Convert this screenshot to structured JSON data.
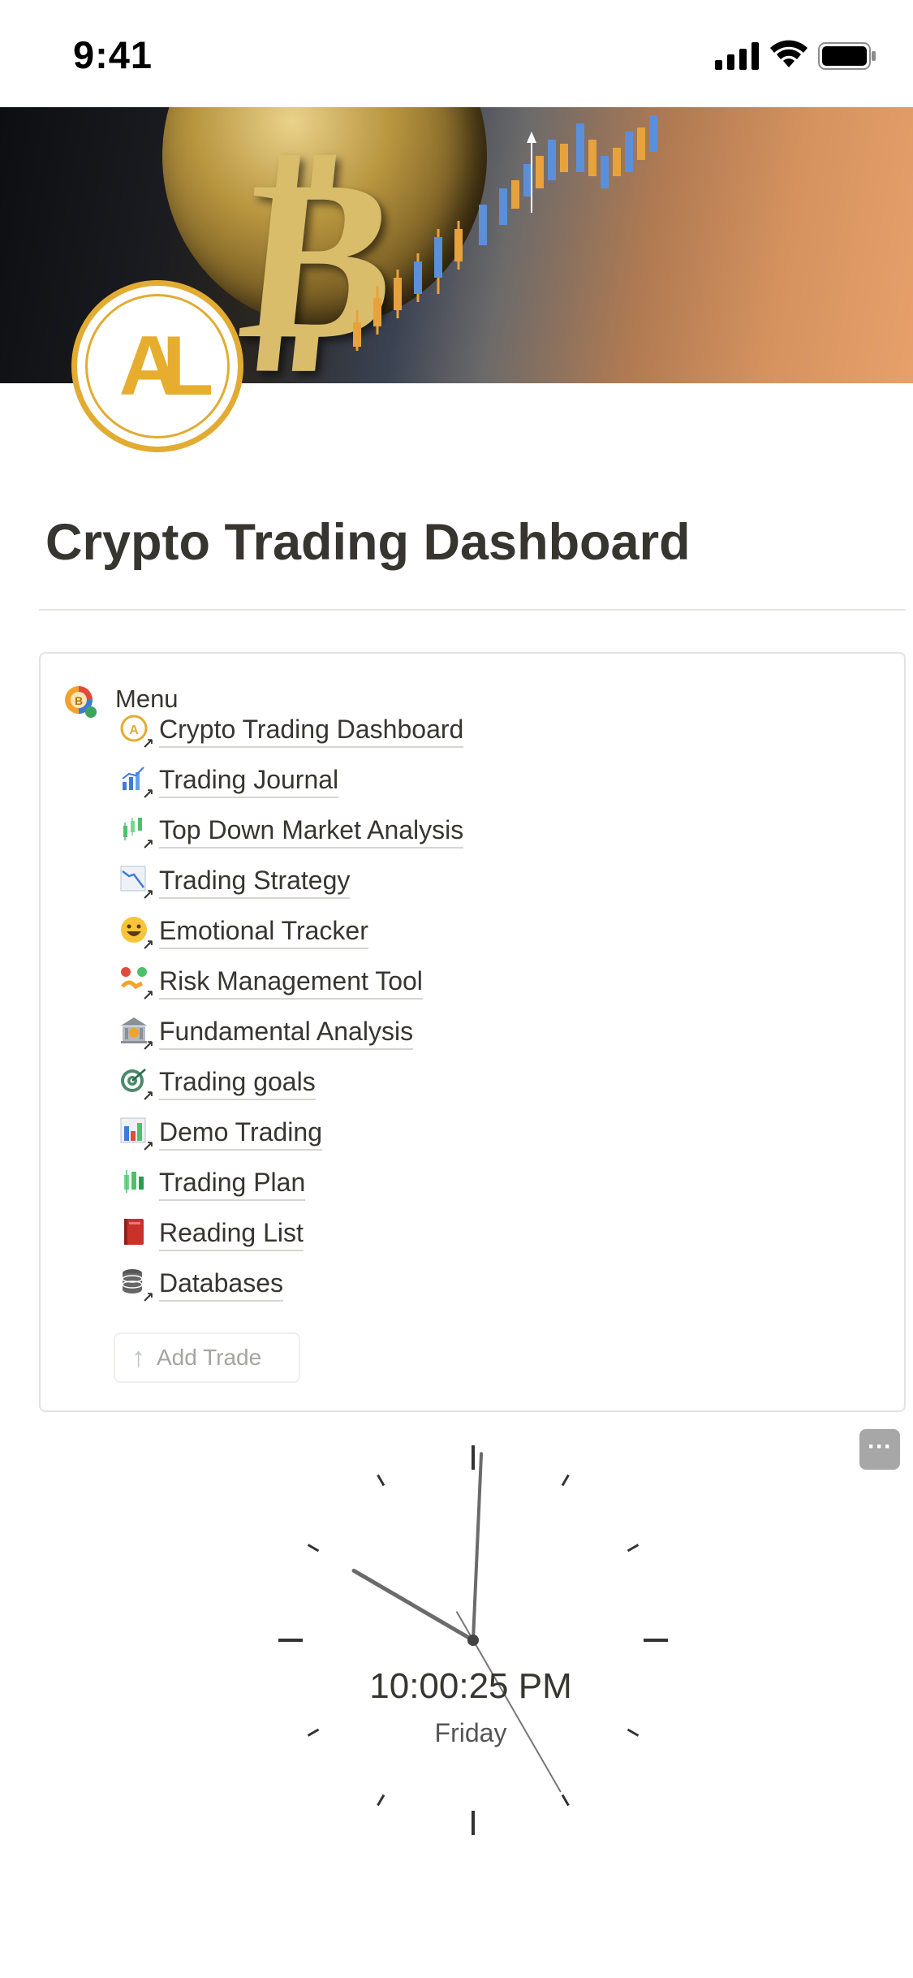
{
  "status_bar": {
    "time": "9:41"
  },
  "logo": {
    "text": "AL"
  },
  "page": {
    "title": "Crypto Trading Dashboard"
  },
  "menu": {
    "label": "Menu",
    "items": [
      {
        "label": "Crypto Trading Dashboard",
        "icon": "al-logo-icon",
        "emoji": "🅐"
      },
      {
        "label": "Trading Journal",
        "icon": "bar-chart-icon",
        "emoji": "📊"
      },
      {
        "label": "Top Down Market Analysis",
        "icon": "candlestick-icon",
        "emoji": "🕯"
      },
      {
        "label": "Trading Strategy",
        "icon": "chart-decreasing-icon",
        "emoji": "📉"
      },
      {
        "label": "Emotional Tracker",
        "icon": "smiley-icon",
        "emoji": "😃"
      },
      {
        "label": "Risk Management Tool",
        "icon": "risk-icon",
        "emoji": "⚖"
      },
      {
        "label": "Fundamental Analysis",
        "icon": "bank-icon",
        "emoji": "🏦"
      },
      {
        "label": "Trading goals",
        "icon": "target-icon",
        "emoji": "🎯"
      },
      {
        "label": "Demo Trading",
        "icon": "bar-chart-color-icon",
        "emoji": "📊"
      },
      {
        "label": "Trading Plan",
        "icon": "candle-green-icon",
        "emoji": "💹"
      },
      {
        "label": "Reading List",
        "icon": "book-icon",
        "emoji": "📕"
      },
      {
        "label": "Databases",
        "icon": "database-icon",
        "emoji": "🗄"
      }
    ],
    "add_trade": "Add Trade"
  },
  "clock": {
    "time": "10:00:25 PM",
    "day": "Friday",
    "hour": 10,
    "minute": 0,
    "second": 25
  },
  "colors": {
    "brand_gold": "#e2ab32",
    "text": "#37352f"
  }
}
